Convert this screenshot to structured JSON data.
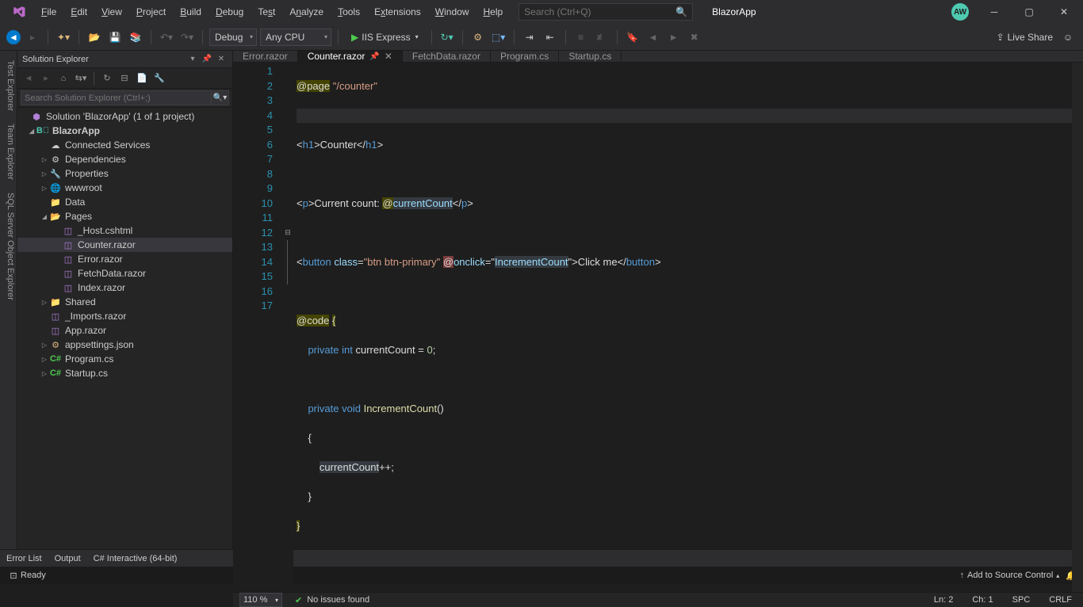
{
  "title": {
    "app_name": "BlazorApp",
    "avatar": "AW"
  },
  "menu": {
    "file": "File",
    "edit": "Edit",
    "view": "View",
    "project": "Project",
    "build": "Build",
    "debug": "Debug",
    "test": "Test",
    "analyze": "Analyze",
    "tools": "Tools",
    "extensions": "Extensions",
    "window": "Window",
    "help": "Help"
  },
  "search": {
    "placeholder": "Search (Ctrl+Q)"
  },
  "toolbar": {
    "config": "Debug",
    "platform": "Any CPU",
    "run": "IIS Express",
    "liveshare": "Live Share"
  },
  "leftrail": {
    "test": "Test Explorer",
    "team": "Team Explorer",
    "sql": "SQL Server Object Explorer"
  },
  "solution": {
    "title": "Solution Explorer",
    "search_placeholder": "Search Solution Explorer (Ctrl+;)",
    "root": "Solution 'BlazorApp' (1 of 1 project)",
    "project": "BlazorApp",
    "items": {
      "connected": "Connected Services",
      "deps": "Dependencies",
      "props": "Properties",
      "wwwroot": "wwwroot",
      "data": "Data",
      "pages": "Pages",
      "host": "_Host.cshtml",
      "counter": "Counter.razor",
      "error": "Error.razor",
      "fetch": "FetchData.razor",
      "index": "Index.razor",
      "shared": "Shared",
      "imports": "_Imports.razor",
      "app": "App.razor",
      "appsettings": "appsettings.json",
      "program": "Program.cs",
      "startup": "Startup.cs"
    }
  },
  "tabs": {
    "error": "Error.razor",
    "counter": "Counter.razor",
    "fetch": "FetchData.razor",
    "program": "Program.cs",
    "startup": "Startup.cs"
  },
  "code": {
    "page_dir": "@page",
    "page_route": "\"/counter\"",
    "h1_open": "h1",
    "h1_text": "Counter",
    "p_open": "p",
    "p_text": "Current count: ",
    "at": "@",
    "currentCount": "currentCount",
    "button": "button",
    "class_attr": "class",
    "class_val": "\"btn btn-primary\"",
    "onclick": "onclick",
    "onclick_val": "\"",
    "increment": "IncrementCount",
    "click_me": "Click me",
    "code_dir": "@code",
    "private": "private",
    "int": "int",
    "void": "void",
    "eq": " = ",
    "zero": "0",
    "inc_body": "currentCount",
    "pp": "++"
  },
  "editor_status": {
    "zoom": "110 %",
    "issues": "No issues found",
    "ln": "Ln: 2",
    "ch": "Ch: 1",
    "spc": "SPC",
    "crlf": "CRLF"
  },
  "bottom": {
    "errorlist": "Error List",
    "output": "Output",
    "csi": "C# Interactive (64-bit)"
  },
  "status": {
    "ready": "Ready",
    "source": "Add to Source Control"
  }
}
